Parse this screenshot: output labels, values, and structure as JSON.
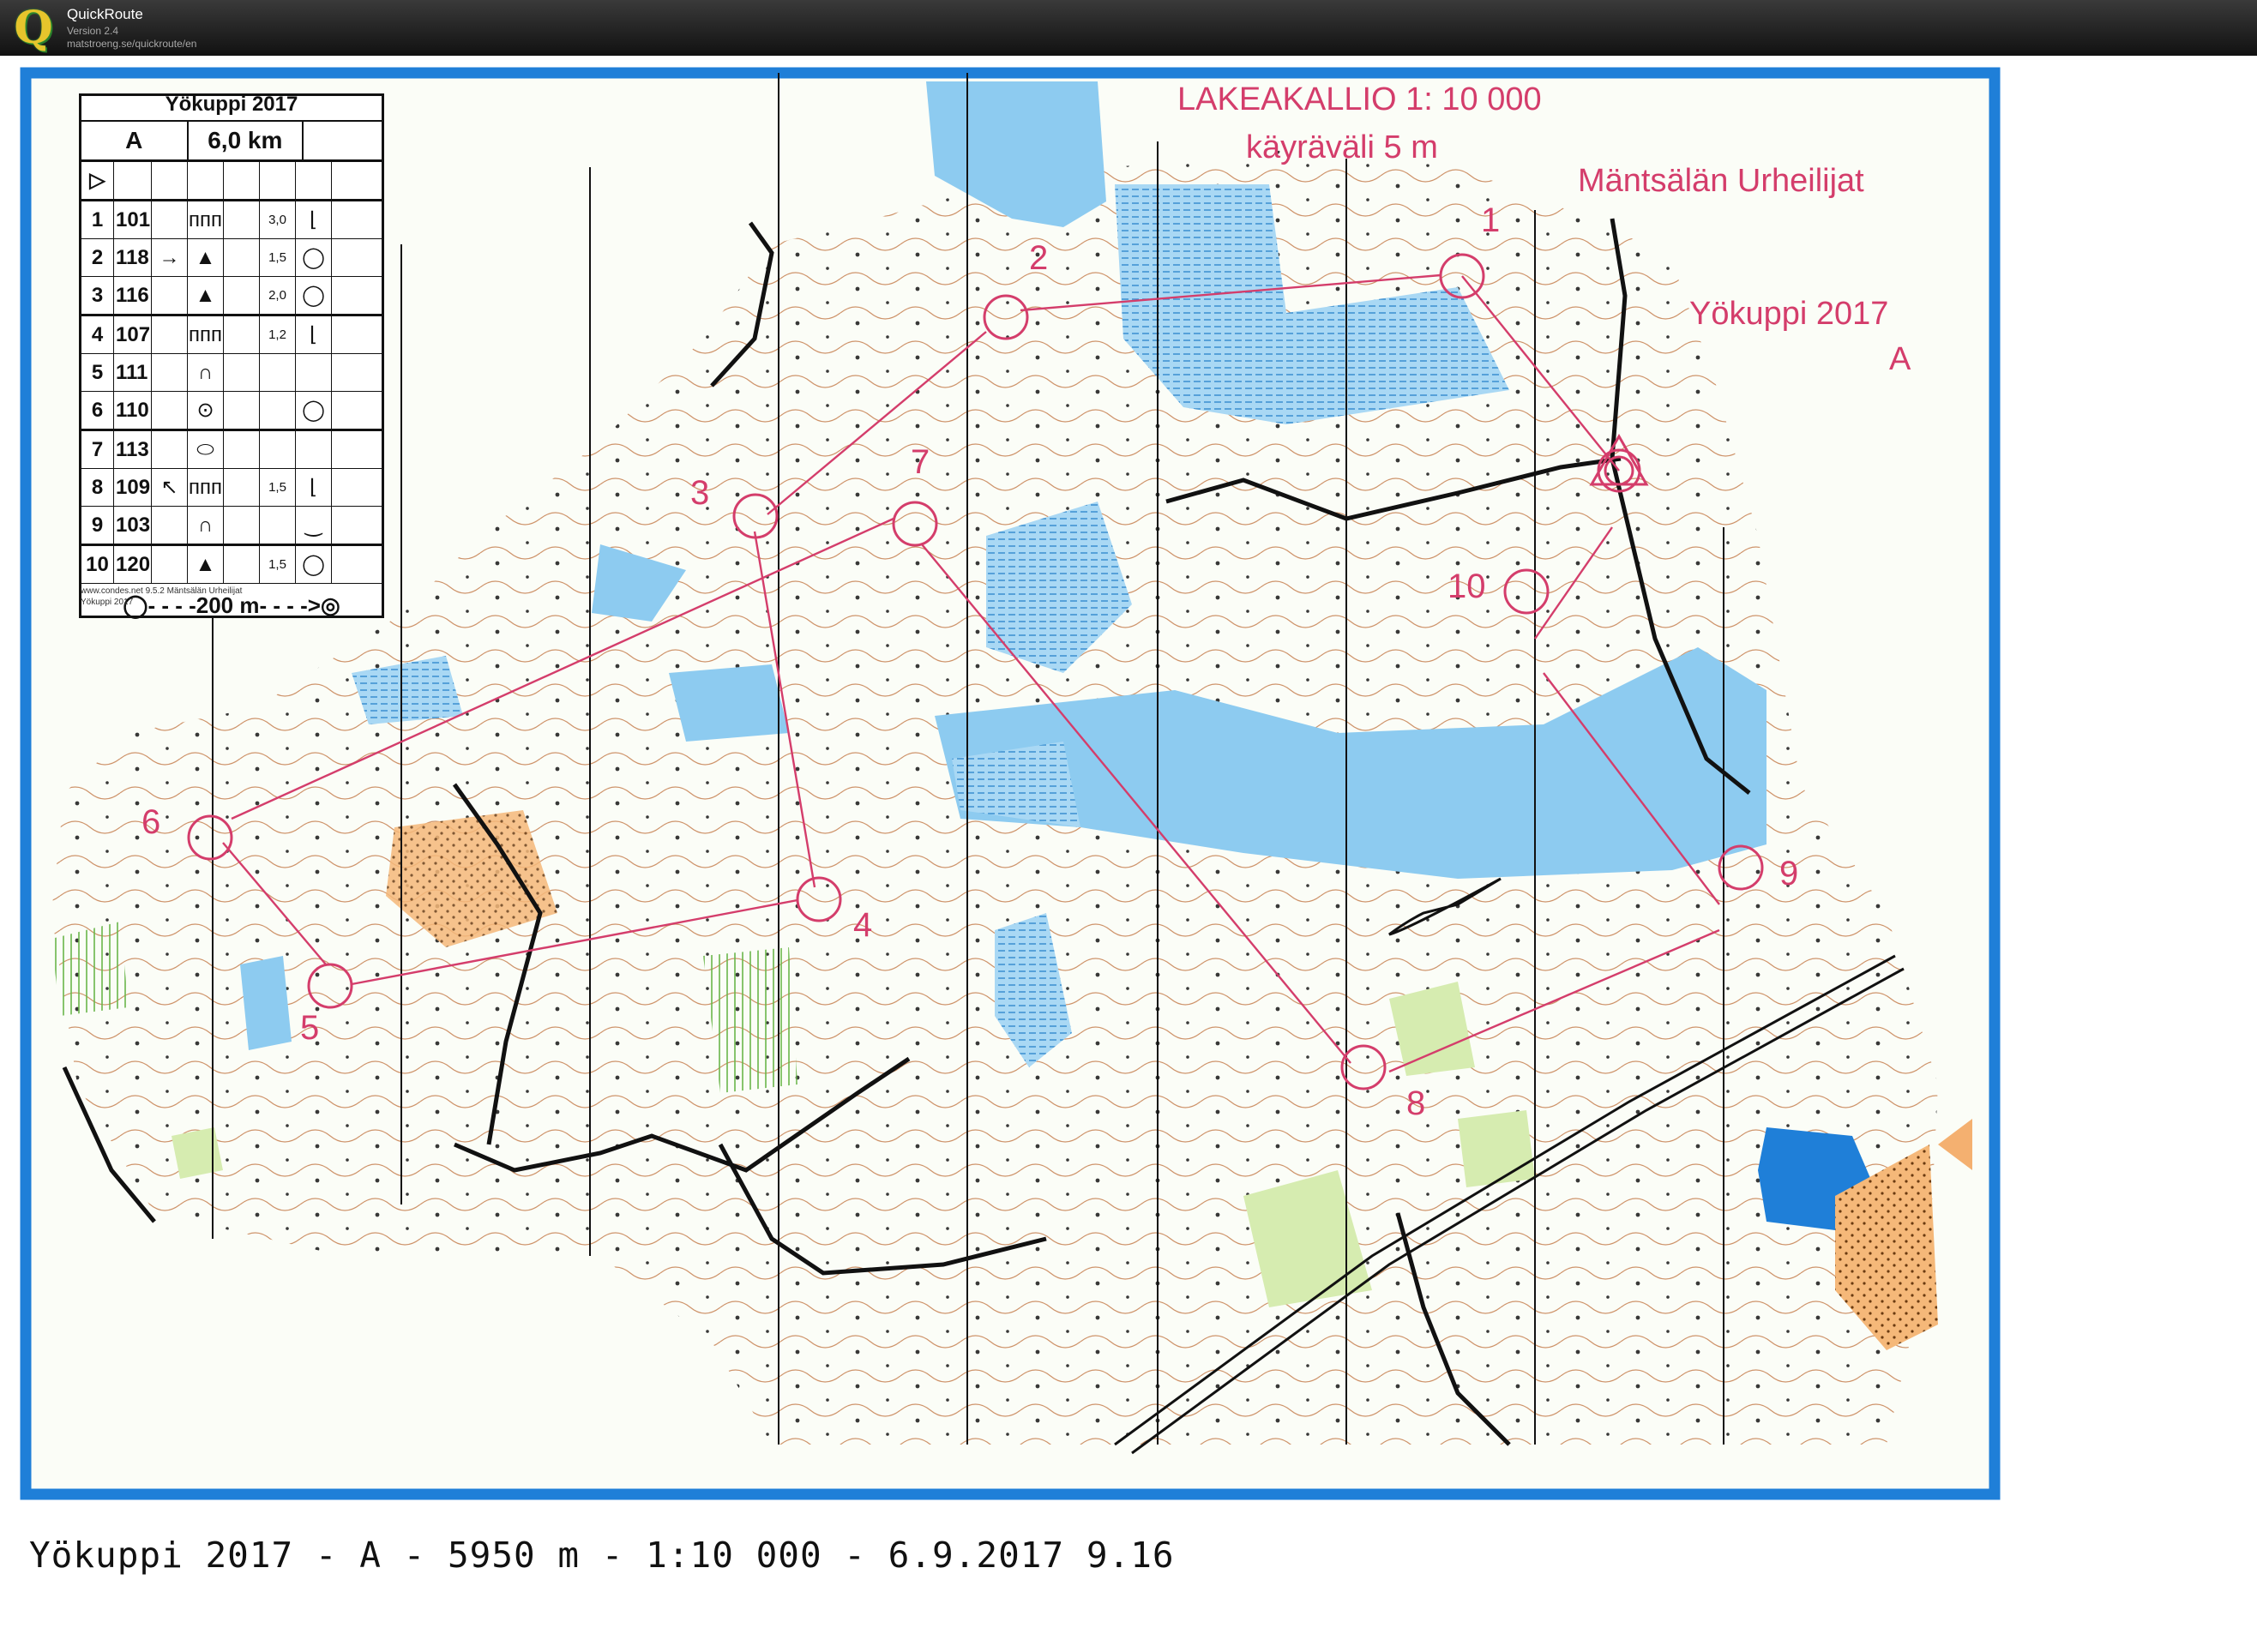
{
  "window": {
    "app_name": "QuickRoute",
    "version": "Version 2.4",
    "url": "matstroeng.se/quickroute/en"
  },
  "map": {
    "title": "LAKEAKALLIO 1: 10 000",
    "contour": "käyräväli 5 m",
    "club": "Mäntsälän Urheilijat",
    "event": "Yökuppi 2017",
    "course": "A"
  },
  "control_descriptions": {
    "title": "Yökuppi 2017",
    "course": "A",
    "length": "6,0 km",
    "rows": [
      {
        "no": "1",
        "code": "101",
        "dir": "",
        "feature": "ᴨᴨᴨ",
        "size": "3,0",
        "loc": "⌊"
      },
      {
        "no": "2",
        "code": "118",
        "dir": "→",
        "feature": "▲",
        "size": "1,5",
        "loc": "◯"
      },
      {
        "no": "3",
        "code": "116",
        "dir": "",
        "feature": "▲",
        "size": "2,0",
        "loc": "◯"
      },
      {
        "no": "4",
        "code": "107",
        "dir": "",
        "feature": "ᴨᴨᴨ",
        "size": "1,2",
        "loc": "⌊"
      },
      {
        "no": "5",
        "code": "111",
        "dir": "",
        "feature": "∩",
        "size": "",
        "loc": ""
      },
      {
        "no": "6",
        "code": "110",
        "dir": "",
        "feature": "⊙",
        "size": "",
        "loc": "◯"
      },
      {
        "no": "7",
        "code": "113",
        "dir": "",
        "feature": "⬭",
        "size": "",
        "loc": ""
      },
      {
        "no": "8",
        "code": "109",
        "dir": "↖",
        "feature": "ᴨᴨᴨ",
        "size": "1,5",
        "loc": "⌊"
      },
      {
        "no": "9",
        "code": "103",
        "dir": "",
        "feature": "∩",
        "size": "",
        "loc": "‿"
      },
      {
        "no": "10",
        "code": "120",
        "dir": "",
        "feature": "▲",
        "size": "1,5",
        "loc": "◯"
      }
    ],
    "finish": "◯- - - -200 m- - - ->◎",
    "credit_1": "www.condes.net 9.5.2 Mäntsälän Urheilijat",
    "credit_2": "Yökuppi 2017"
  },
  "controls": [
    {
      "label": "1"
    },
    {
      "label": "2"
    },
    {
      "label": "3"
    },
    {
      "label": "4"
    },
    {
      "label": "5"
    },
    {
      "label": "6"
    },
    {
      "label": "7"
    },
    {
      "label": "8"
    },
    {
      "label": "9"
    },
    {
      "label": "10"
    }
  ],
  "caption": "Yökuppi 2017 - A - 5950 m - 1:10 000 - 6.9.2017 9.16",
  "colors": {
    "course": "#d43d6b",
    "water": "#7ec4ec",
    "border": "#1f7fd8",
    "green": "#c8e6a0",
    "orange": "#f4b070",
    "titlebar": "#1a1a1a"
  }
}
